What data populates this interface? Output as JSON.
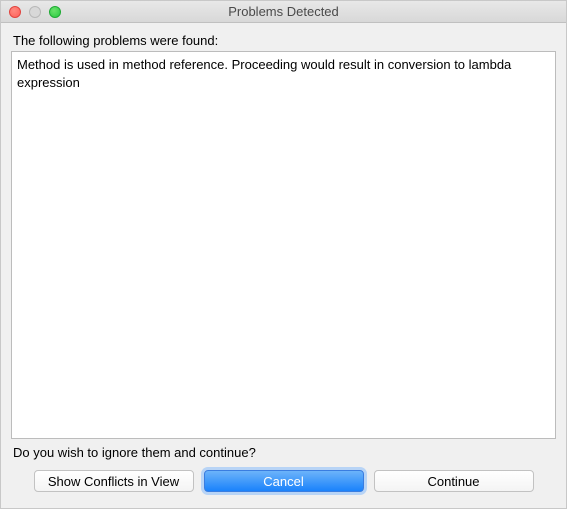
{
  "window": {
    "title": "Problems Detected"
  },
  "content": {
    "heading": "The following problems were found:",
    "problem_text": "Method is used in method reference. Proceeding would result in conversion to lambda expression",
    "prompt": "Do you wish to ignore them and continue?"
  },
  "buttons": {
    "show_conflicts": "Show Conflicts in View",
    "cancel": "Cancel",
    "continue": "Continue"
  }
}
